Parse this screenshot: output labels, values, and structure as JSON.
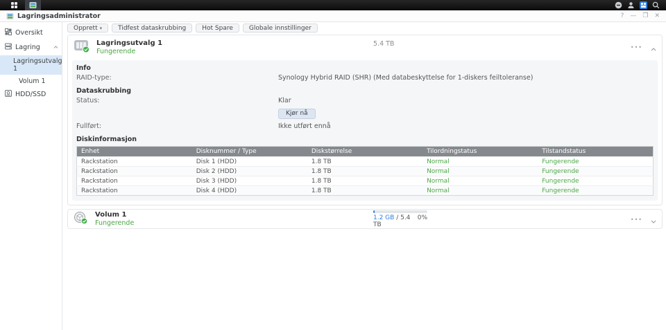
{
  "taskbar": {
    "icons": [
      "apps-grid",
      "storage-manager-app",
      "notifications",
      "user",
      "widgets",
      "search"
    ]
  },
  "window": {
    "title": "Lagringsadministrator",
    "controls": {
      "help": "?",
      "minimize": "—",
      "maximize": "❐",
      "close": "✕"
    }
  },
  "sidebar": {
    "items": {
      "overview": "Oversikt",
      "storage": "Lagring",
      "pool": "Lagringsutvalg 1",
      "volume": "Volum 1",
      "hdd": "HDD/SSD"
    }
  },
  "toolbar": {
    "buttons": [
      {
        "label": "Opprett",
        "caret": "▾"
      },
      {
        "label": "Tidfest dataskrubbing"
      },
      {
        "label": "Hot Spare"
      },
      {
        "label": "Globale innstillinger"
      }
    ]
  },
  "pool_panel": {
    "title": "Lagringsutvalg 1",
    "status": "Fungerende",
    "capacity": "5.4 TB",
    "more_icon": "•••",
    "info": {
      "heading": "Info",
      "raid_label": "RAID-type:",
      "raid_value": "Synology Hybrid RAID (SHR) (Med databeskyttelse for 1-diskers feiltoleranse)"
    },
    "scrub": {
      "heading": "Dataskrubbing",
      "status_label": "Status:",
      "status_value": "Klar",
      "run_button": "Kjør nå",
      "done_label": "Fullført:",
      "done_value": "Ikke utført ennå"
    },
    "disks": {
      "heading": "Diskinformasjon",
      "columns": [
        "Enhet",
        "Disknummer / Type",
        "Diskstørrelse",
        "Tilordningstatus",
        "Tilstandstatus"
      ],
      "rows": [
        {
          "device": "Rackstation",
          "disk": "Disk 1 (HDD)",
          "size": "1.8 TB",
          "alloc": "Normal",
          "health": "Fungerende"
        },
        {
          "device": "Rackstation",
          "disk": "Disk 2 (HDD)",
          "size": "1.8 TB",
          "alloc": "Normal",
          "health": "Fungerende"
        },
        {
          "device": "Rackstation",
          "disk": "Disk 3 (HDD)",
          "size": "1.8 TB",
          "alloc": "Normal",
          "health": "Fungerende"
        },
        {
          "device": "Rackstation",
          "disk": "Disk 4 (HDD)",
          "size": "1.8 TB",
          "alloc": "Normal",
          "health": "Fungerende"
        }
      ]
    }
  },
  "volume_panel": {
    "title": "Volum 1",
    "status": "Fungerende",
    "used": "1.2 GB",
    "total": "/ 5.4 TB",
    "percent": "0%",
    "more_icon": "•••"
  },
  "colors": {
    "status_green": "#4da747",
    "link_blue": "#2a7ee2",
    "widget_blue": "#2f7fe0",
    "selected_item": "#d9e8f8",
    "table_header": "#85898d",
    "taskbar": "#141414"
  }
}
